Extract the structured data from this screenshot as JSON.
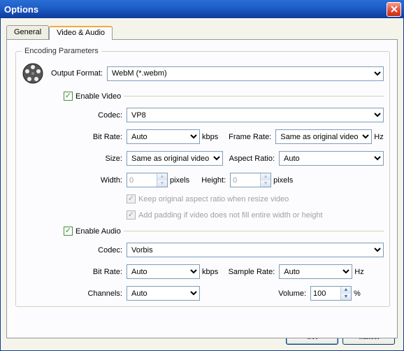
{
  "window": {
    "title": "Options"
  },
  "tabs": {
    "general": "General",
    "video_audio": "Video & Audio"
  },
  "encoding": {
    "legend": "Encoding Parameters",
    "output_format_label": "Output Format:",
    "output_format_value": "WebM (*.webm)",
    "enable_video": "Enable Video",
    "enable_audio": "Enable Audio",
    "video": {
      "codec_label": "Codec:",
      "codec_value": "VP8",
      "bitrate_label": "Bit Rate:",
      "bitrate_value": "Auto",
      "bitrate_unit": "kbps",
      "framerate_label": "Frame Rate:",
      "framerate_value": "Same as original video",
      "framerate_unit": "Hz",
      "size_label": "Size:",
      "size_value": "Same as original video",
      "aspect_label": "Aspect Ratio:",
      "aspect_value": "Auto",
      "width_label": "Width:",
      "width_value": "0",
      "height_label": "Height:",
      "height_value": "0",
      "pixels_unit": "pixels",
      "keep_aspect": "Keep original aspect ratio when resize video",
      "add_padding": "Add padding if video does not fill entire width or height"
    },
    "audio": {
      "codec_label": "Codec:",
      "codec_value": "Vorbis",
      "bitrate_label": "Bit Rate:",
      "bitrate_value": "Auto",
      "bitrate_unit": "kbps",
      "samplerate_label": "Sample Rate:",
      "samplerate_value": "Auto",
      "samplerate_unit": "Hz",
      "channels_label": "Channels:",
      "channels_value": "Auto",
      "volume_label": "Volume:",
      "volume_value": "100",
      "volume_unit": "%"
    }
  },
  "buttons": {
    "ok": "OK",
    "cancel": "Cancel"
  }
}
